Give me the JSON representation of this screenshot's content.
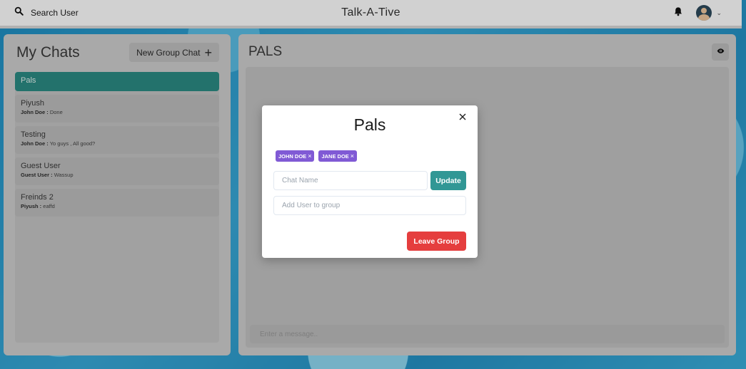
{
  "header": {
    "search_label": "Search User",
    "app_title": "Talk-A-Tive"
  },
  "left": {
    "title": "My Chats",
    "new_group_label": "New Group Chat",
    "chats": [
      {
        "name": "Pals",
        "active": true
      },
      {
        "name": "Piyush",
        "sender": "John Doe :",
        "message": "Done"
      },
      {
        "name": "Testing",
        "sender": "John Doe :",
        "message": "Yo guys , All good?"
      },
      {
        "name": "Guest User",
        "sender": "Guest User :",
        "message": "Wassup"
      },
      {
        "name": "Freinds 2",
        "sender": "Piyush :",
        "message": "eaffd"
      }
    ]
  },
  "right": {
    "chat_title": "PALS",
    "message_placeholder": "Enter a message.."
  },
  "modal": {
    "title": "Pals",
    "members": [
      "JOHN DOE",
      "JANE DOE"
    ],
    "chat_name_placeholder": "Chat Name",
    "update_label": "Update",
    "add_user_placeholder": "Add User to group",
    "leave_label": "Leave Group"
  },
  "colors": {
    "active_chat": "#2b8c84",
    "badge": "#805ad5",
    "update_button": "#319795",
    "leave_button": "#e53e3e"
  },
  "icons": [
    "search-icon",
    "bell-icon",
    "user-avatar",
    "chevron-down-icon",
    "plus-icon",
    "eye-icon",
    "close-icon"
  ]
}
